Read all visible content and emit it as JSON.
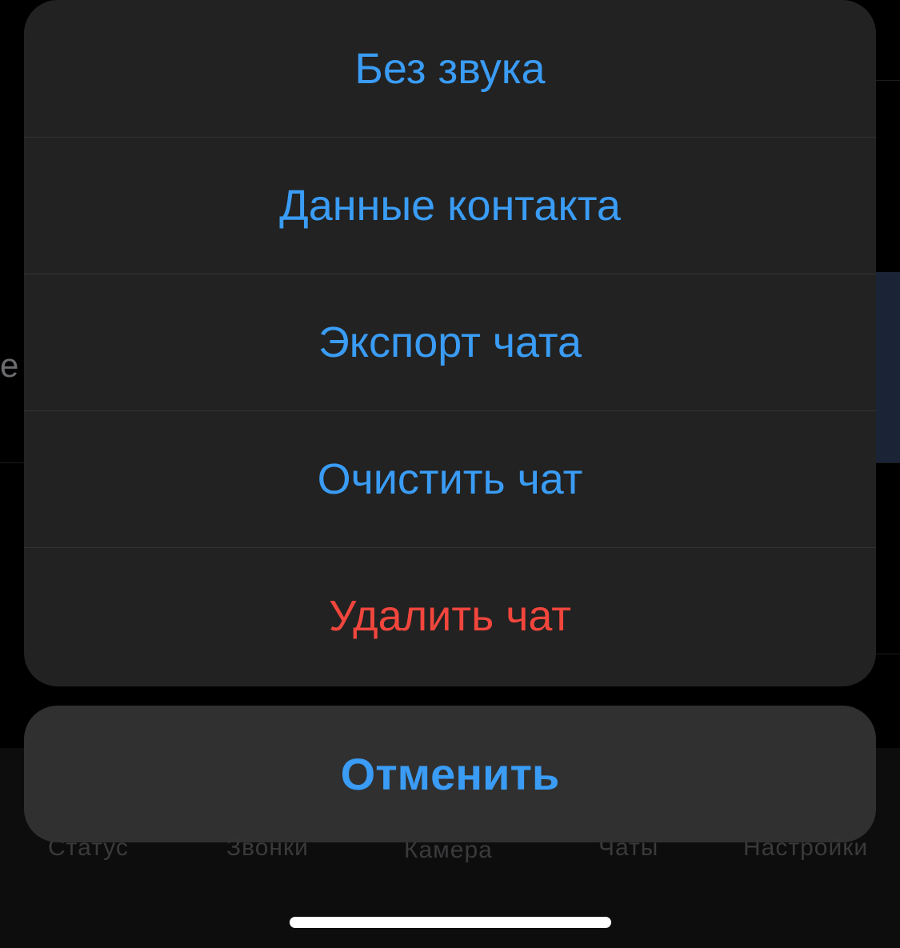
{
  "background": {
    "fragment_text": "е",
    "tabs": [
      {
        "label": "Статус"
      },
      {
        "label": "Звонки"
      },
      {
        "label": "Камера"
      },
      {
        "label": "Чаты"
      },
      {
        "label": "Настройки"
      }
    ]
  },
  "action_sheet": {
    "items": [
      {
        "label": "Без звука"
      },
      {
        "label": "Данные контакта"
      },
      {
        "label": "Экспорт чата"
      },
      {
        "label": "Очистить чат"
      },
      {
        "label": "Удалить чат"
      }
    ],
    "cancel_label": "Отменить"
  },
  "colors": {
    "action_blue": "#3a9cf5",
    "destructive_red": "#f2463d",
    "sheet_background": "#222222",
    "cancel_background": "#323232"
  }
}
